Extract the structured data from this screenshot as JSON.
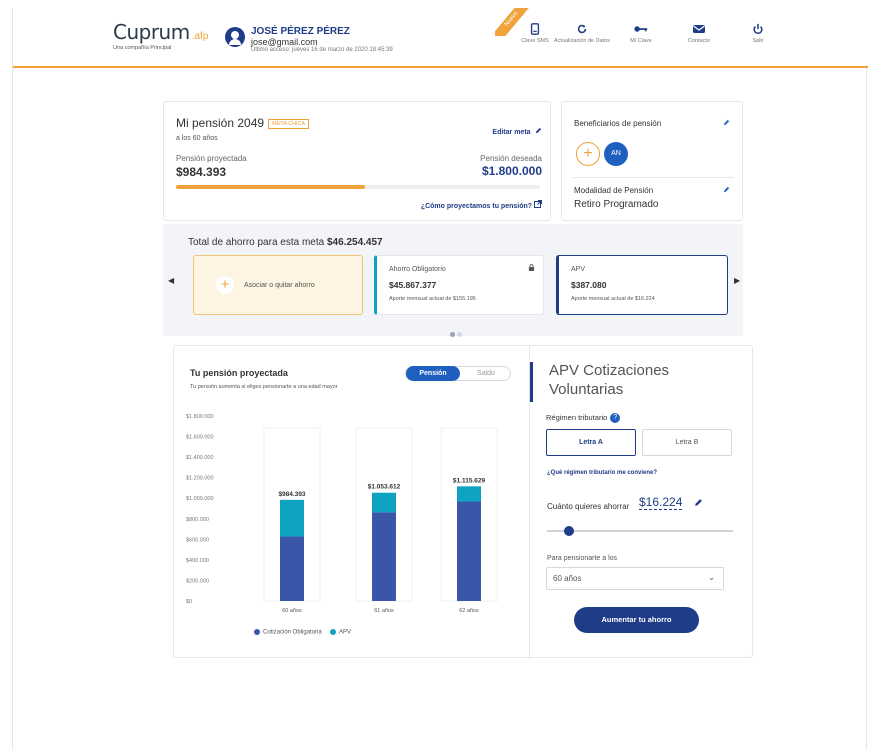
{
  "header": {
    "logo": "Cuprum",
    "logo_afp": ".afp",
    "logo_tagline": "Una compañía Principal",
    "user_name": "JOSÉ PÉREZ PÉREZ",
    "user_email": "jose@gmail.com",
    "last_access": "Último acceso: jueves 16 de marzo de 2020 18:45:39",
    "new_badge": "Nuevo",
    "nav": [
      {
        "label": "Clave SMS",
        "icon": "phone-icon"
      },
      {
        "label": "Actualización de Datos",
        "icon": "refresh-icon"
      },
      {
        "label": "Mi Clave",
        "icon": "key-icon"
      },
      {
        "label": "Contacto",
        "icon": "mail-icon"
      },
      {
        "label": "Salir",
        "icon": "power-icon"
      }
    ]
  },
  "pension": {
    "title": "Mi pensión 2049",
    "tag": "META CHICA",
    "age_sub": "a los 60 años",
    "edit_label": "Editar meta",
    "projected_label": "Pensión proyectada",
    "projected_value": "$984.393",
    "desired_label": "Pensión deseada",
    "desired_value": "$1.800.000",
    "progress_fraction": 0.52,
    "how_link": "¿Cómo proyectamos tu pensión?"
  },
  "beneficiaries": {
    "title": "Beneficiarios de pensión",
    "initials": "AN",
    "modality_title": "Modalidad de Pensión",
    "modality_value": "Retiro Programado"
  },
  "savings": {
    "total_label": "Total de ahorro para esta meta",
    "total_value": "$46.254.457",
    "add_label": "Asociar o quitar ahorro",
    "obligatorio": {
      "name": "Ahorro Obligatorio",
      "value": "$45.867.377",
      "sub": "Aporte mensual actual de $155.195"
    },
    "apv": {
      "name": "APV",
      "value": "$387.080",
      "sub": "Aporte mensual actual de $16.224"
    }
  },
  "projection": {
    "title": "Tu pensión proyectada",
    "subtitle": "Tu pensión aumenta si eliges pensionarte a una edad mayor",
    "toggle_on": "Pensión",
    "toggle_off": "Saldo"
  },
  "chart_data": {
    "type": "bar",
    "stacked": true,
    "categories": [
      "60 años",
      "61 años",
      "62 años"
    ],
    "series": [
      {
        "name": "Cotización Obligatoria",
        "color": "#3a56a8",
        "values": [
          628000,
          862000,
          968000
        ]
      },
      {
        "name": "APV",
        "color": "#0fa3c2",
        "values": [
          356393,
          191612,
          147629
        ]
      }
    ],
    "data_labels": [
      "$984.393",
      "$1.053.612",
      "$1.115.629"
    ],
    "yticks": [
      "$1.800.000",
      "$1.600.000",
      "$1.400.000",
      "$1.200.000",
      "$1.000.000",
      "$800.000",
      "$600.000",
      "$400.000",
      "$200.000",
      "$0"
    ],
    "ylim": [
      0,
      1800000
    ],
    "grid": false,
    "legend": "bottom"
  },
  "apv_form": {
    "title_line1": "APV Cotizaciones",
    "title_line2": "Voluntarias",
    "regimen_label": "Régimen tributario",
    "help": "?",
    "letra_a": "Letra A",
    "letra_b": "Letra B",
    "which_link": "¿Qué régimen tributario me conviene?",
    "amount_label": "Cuánto quieres ahorrar",
    "amount_value": "$16.224",
    "slider_fraction": 0.12,
    "retire_label": "Para pensionarte a los",
    "retire_value": "60 años",
    "cta": "Aumentar tu ahorro"
  }
}
